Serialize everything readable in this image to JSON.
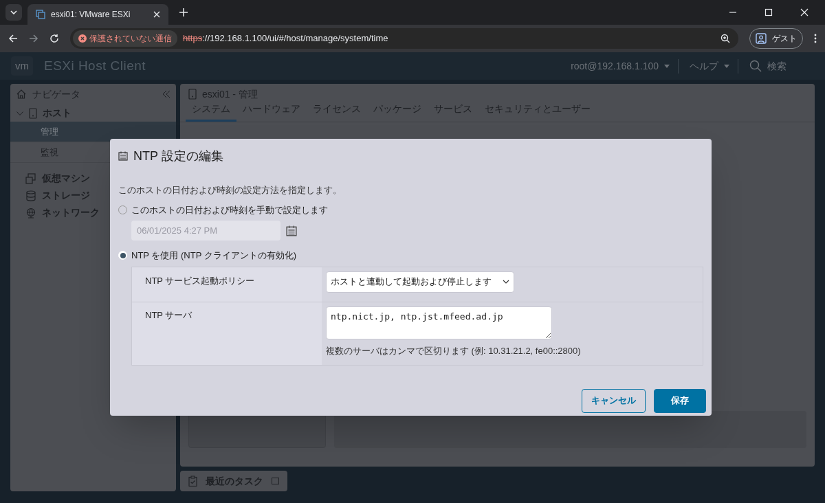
{
  "browser": {
    "tab_title": "esxi01: VMware ESXi",
    "security": "保護されていない通信",
    "url_scheme": "https",
    "url_rest": "://192.168.1.100/ui/#/host/manage/system/time",
    "profile": "ゲスト"
  },
  "app": {
    "logo": "vm",
    "title": "ESXi Host Client",
    "user": "root@192.168.1.100",
    "help": "ヘルプ",
    "search": "検索"
  },
  "navigator": {
    "title": "ナビゲータ",
    "items": [
      {
        "label": "ホスト",
        "expanded": true,
        "selected": false,
        "children": [
          {
            "label": "管理",
            "selected": true
          },
          {
            "label": "監視",
            "selected": false
          }
        ]
      },
      {
        "label": "仮想マシン",
        "selected": false
      },
      {
        "label": "ストレージ",
        "selected": false
      },
      {
        "label": "ネットワーク",
        "selected": false
      }
    ]
  },
  "main": {
    "title": "esxi01 - 管理",
    "tabs": [
      {
        "label": "システム",
        "selected": true
      },
      {
        "label": "ハードウェア",
        "selected": false
      },
      {
        "label": "ライセンス",
        "selected": false
      },
      {
        "label": "パッケージ",
        "selected": false
      },
      {
        "label": "サービス",
        "selected": false
      },
      {
        "label": "セキュリティとユーザー",
        "selected": false
      }
    ]
  },
  "dialog": {
    "title": "NTP 設定の編集",
    "description": "このホストの日付および時刻の設定方法を指定します。",
    "options": [
      {
        "label": "このホストの日付および時刻を手動で設定します",
        "selected": false
      },
      {
        "label": "NTP を使用 (NTP クライアントの有効化)",
        "selected": true
      }
    ],
    "date_field": {
      "value": "06/01/2025 4:27 PM",
      "disabled": true
    },
    "policy_label": "NTP サービス起動ポリシー",
    "policy_value": "ホストと連動して起動および停止します",
    "server_label": "NTP サーバ",
    "server_value": "ntp.nict.jp, ntp.jst.mfeed.ad.jp",
    "server_hint": "複数のサーバはカンマで区切ります (例: 10.31.21.2, fe00::2800)",
    "buttons": [
      {
        "label": "キャンセル",
        "kind": "secondary"
      },
      {
        "label": "保存",
        "kind": "primary"
      }
    ]
  },
  "tasks": {
    "title": "最近のタスク"
  }
}
